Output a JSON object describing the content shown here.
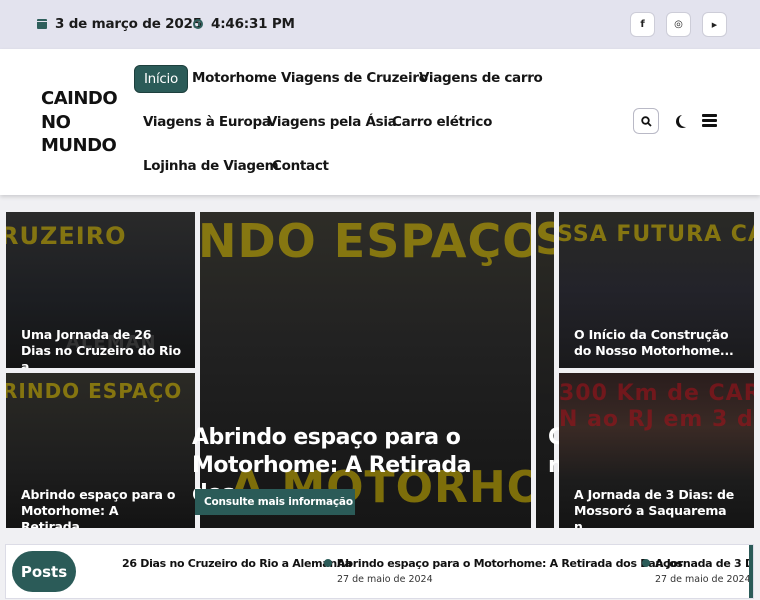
{
  "topbar": {
    "date": "3 de março de 2025",
    "time": "4:46:31 PM",
    "social": [
      {
        "icon": "facebook-icon",
        "glyph": "f"
      },
      {
        "icon": "instagram-icon",
        "glyph": "◎"
      },
      {
        "icon": "youtube-icon",
        "glyph": "▶"
      }
    ]
  },
  "header": {
    "logo_line1": "CAINDO",
    "logo_line2": "NO",
    "logo_line3": "MUNDO",
    "nav": [
      "Início",
      "Motorhome",
      "Viagens de Cruzeiro",
      "Viagens de carro",
      "Viagens à Europa",
      "Viagens pela Ásia",
      "Carro elétrico",
      "Lojinha de Viagem",
      "Contact"
    ]
  },
  "cards": {
    "left_top": {
      "title": "Uma Jornada de 26 Dias no Cruzeiro do Rio a..."
    },
    "left_bottom": {
      "title": "Abrindo espaço para o Motorhome: A Retirada..."
    },
    "center": {
      "title": "Abrindo espaço para o Motorhome: A Retirada dos...",
      "button": "Consulte mais informação"
    },
    "right_top": {
      "title": "O Início da Construção do Nosso Motorhome..."
    },
    "right_bottom": {
      "title": "A Jornada de 3 Dias: de Mossoró a Saquarema n..."
    }
  },
  "ticker": {
    "label": "Posts",
    "items": [
      {
        "title": "26 Dias no Cruzeiro do Rio a Alemanha",
        "date": ""
      },
      {
        "title": "Abrindo espaço para o Motorhome: A Retirada dos Bancos",
        "date": "27 de maio de 2024"
      },
      {
        "title": "A Jornada de 3 D",
        "date": "27 de maio de 2024"
      }
    ]
  },
  "colors": {
    "accent": "#2b5b58",
    "topbar": "#e3e3ee"
  }
}
